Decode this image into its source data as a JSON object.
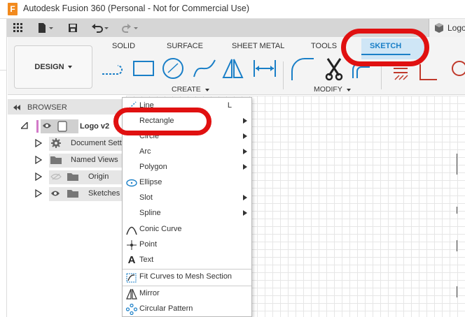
{
  "window": {
    "title": "Autodesk Fusion 360 (Personal - Not for Commercial Use)",
    "app_logo": "F"
  },
  "document_tab": {
    "label": "Logo"
  },
  "workspace": {
    "label": "DESIGN"
  },
  "tabs": [
    "SOLID",
    "SURFACE",
    "SHEET METAL",
    "TOOLS",
    "SKETCH"
  ],
  "active_tab": "SKETCH",
  "groups": {
    "create": "CREATE",
    "modify": "MODIFY"
  },
  "browser": {
    "title": "BROWSER",
    "items": [
      {
        "label": "Logo v2"
      },
      {
        "label": "Document Setti"
      },
      {
        "label": "Named Views"
      },
      {
        "label": "Origin"
      },
      {
        "label": "Sketches"
      }
    ]
  },
  "create_menu": {
    "items": [
      {
        "label": "Line",
        "shortcut": "L",
        "icon": "line-icon"
      },
      {
        "label": "Rectangle",
        "submenu": true
      },
      {
        "label": "Circle",
        "submenu": true
      },
      {
        "label": "Arc",
        "submenu": true
      },
      {
        "label": "Polygon",
        "submenu": true
      },
      {
        "label": "Ellipse",
        "icon": "ellipse-icon"
      },
      {
        "label": "Slot",
        "submenu": true
      },
      {
        "label": "Spline",
        "submenu": true
      },
      {
        "label": "Conic Curve",
        "icon": "conic-curve-icon"
      },
      {
        "label": "Point",
        "icon": "point-icon"
      },
      {
        "label": "Text",
        "icon": "text-icon"
      },
      {
        "label": "Fit Curves to Mesh Section",
        "icon": "fit-curves-icon"
      },
      {
        "label": "Mirror",
        "icon": "mirror-icon"
      },
      {
        "label": "Circular Pattern",
        "icon": "circular-pattern-icon"
      }
    ]
  },
  "colors": {
    "highlight_red": "#e01010",
    "accent_blue": "#1a7fc7",
    "app_orange": "#f28a1e"
  }
}
